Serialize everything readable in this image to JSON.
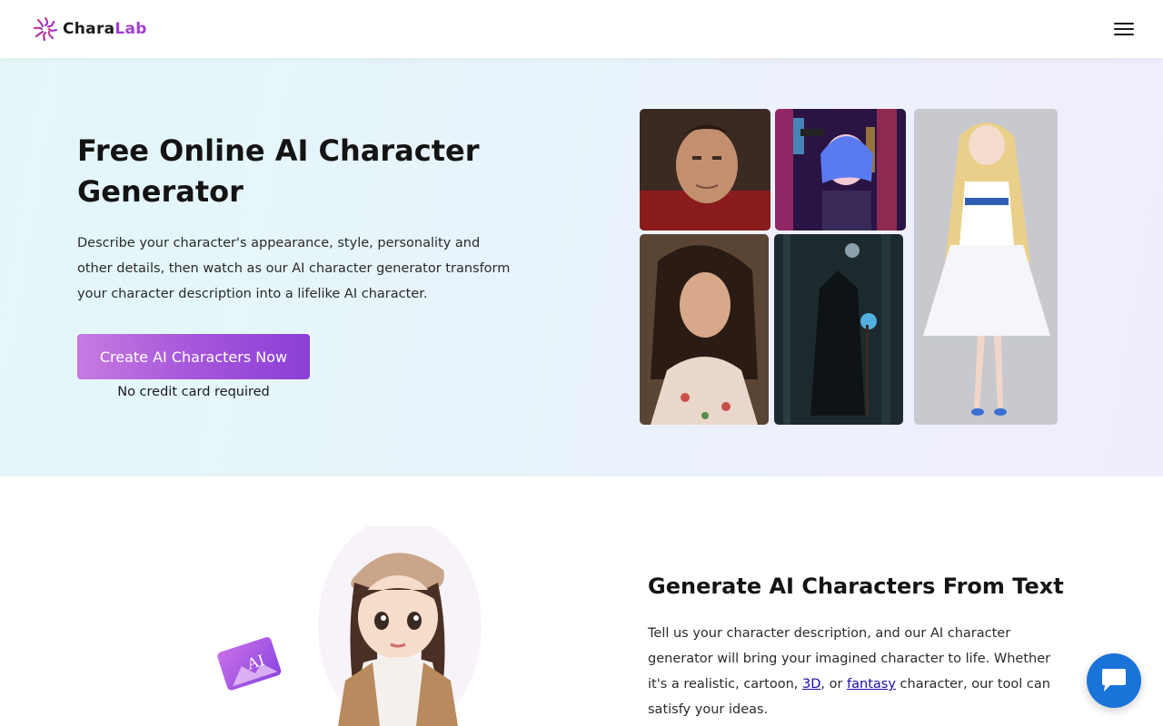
{
  "header": {
    "logo_part1": "Chara",
    "logo_part2": "Lab",
    "menu_icon": "hamburger-menu-icon"
  },
  "hero": {
    "title": "Free Online AI Character Generator",
    "description": "Describe your character's appearance, style, personality and other details, then watch as our AI character generator transform your character description into a lifelike AI character.",
    "cta_label": "Create AI Characters Now",
    "cta_note": "No credit card required",
    "gallery": [
      {
        "subject": "realistic man portrait"
      },
      {
        "subject": "anime girl with gun in neon city"
      },
      {
        "subject": "realistic woman portrait"
      },
      {
        "subject": "hooded wizard in dark forest"
      },
      {
        "subject": "anime girl in white dress"
      }
    ]
  },
  "section2": {
    "title": "Generate AI Characters From Text",
    "desc_before": "Tell us your character description, and our AI character generator will bring your imagined character to life. Whether it's a realistic, cartoon, ",
    "link_3d": "3D",
    "desc_mid": ", or ",
    "link_fantasy": "fantasy",
    "desc_after": " character, our tool can satisfy your ideas.",
    "illustration_badge": "AI"
  },
  "chat": {
    "icon": "chat-bubble-icon"
  },
  "colors": {
    "brand_purple": "#a13fd1",
    "cta_gradient_start": "#c77ae0",
    "cta_gradient_end": "#8a3fd6",
    "link": "#1a0dab",
    "chat_button": "#1a73d9"
  }
}
